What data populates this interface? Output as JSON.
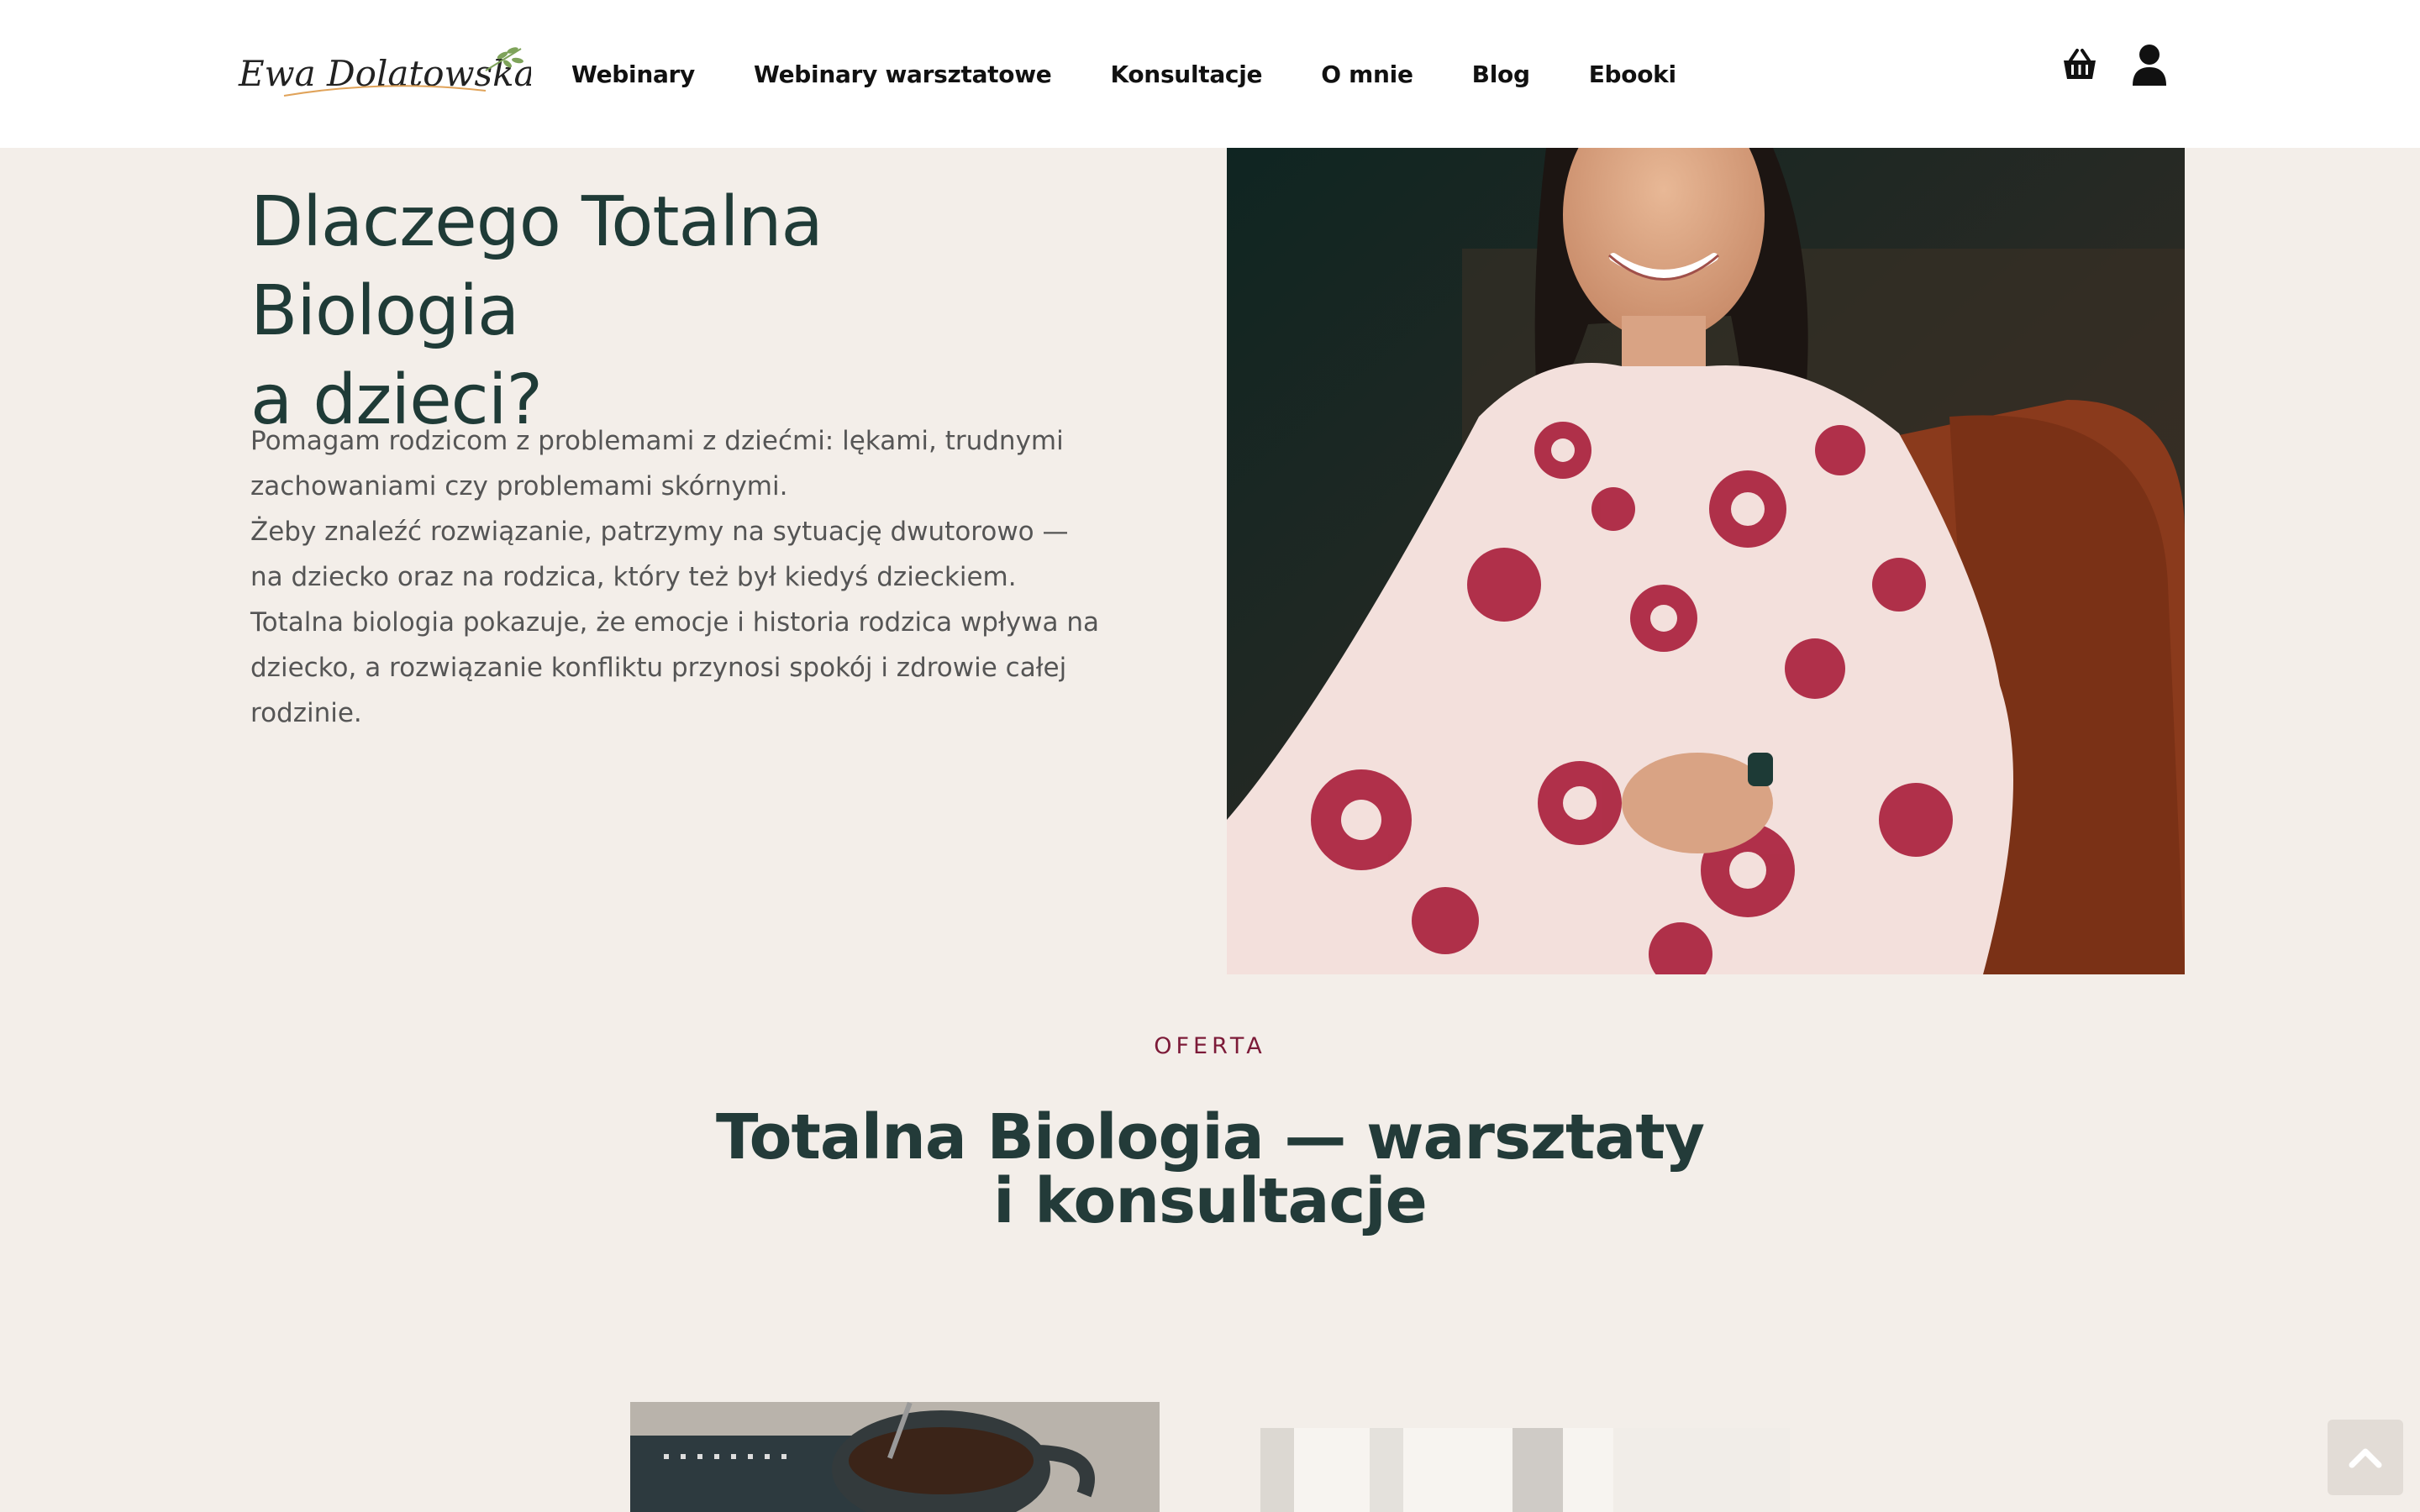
{
  "header": {
    "logo_text": "Ewa Dolatowska",
    "nav": [
      {
        "label": "Webinary"
      },
      {
        "label": "Webinary warsztatowe"
      },
      {
        "label": "Konsultacje"
      },
      {
        "label": "O mnie"
      },
      {
        "label": "Blog"
      },
      {
        "label": "Ebooki"
      }
    ],
    "icons": [
      "cart-icon",
      "user-icon"
    ]
  },
  "hero": {
    "title_line1": "Dlaczego Totalna Biologia",
    "title_line2": "a dzieci?",
    "paragraph1": "Pomagam rodzicom z problemami z dziećmi: lękami, trudnymi zachowaniami czy problemami skórnymi.",
    "paragraph2": "Żeby znaleźć rozwiązanie, patrzymy na sytuację dwutorowo — na dziecko oraz na rodzica, który też był kiedyś dzieckiem. Totalna biologia pokazuje, że emocje i historia rodzica wpływa na dziecko, a rozwiązanie konfliktu przynosi spokój i zdrowie całej rodzinie."
  },
  "offer": {
    "label": "OFERTA",
    "title": "Totalna Biologia — warsztaty i konsultacje"
  },
  "colors": {
    "background": "#f3eee9",
    "heading": "#1f3b37",
    "accent": "#7c1a38",
    "text": "#555555"
  }
}
